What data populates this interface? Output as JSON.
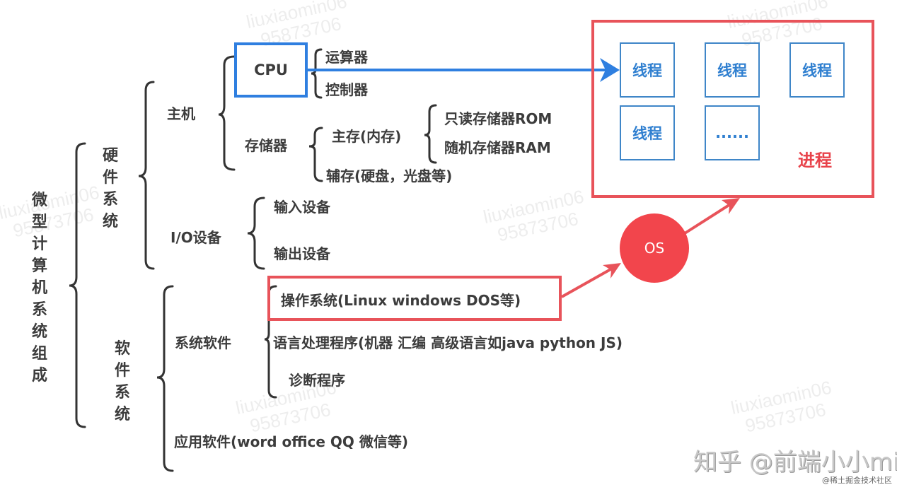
{
  "diagram": {
    "root": "微型计算机系统组成",
    "hardware": {
      "label": "硬件系统",
      "host": {
        "label": "主机",
        "cpu": {
          "label": "CPU",
          "children": [
            "运算器",
            "控制器"
          ]
        },
        "storage": {
          "label": "存储器",
          "main_memory": {
            "label": "主存(内存)",
            "children": [
              "只读存储器ROM",
              "随机存储器RAM"
            ]
          },
          "aux_memory": "辅存(硬盘，光盘等)"
        }
      },
      "io": {
        "label": "I/O设备",
        "children": [
          "输入设备",
          "输出设备"
        ]
      }
    },
    "software": {
      "label": "软件系统",
      "system_software": {
        "label": "系统软件",
        "children": [
          "操作系统(Linux windows DOS等)",
          "语言处理程序(机器 汇编 高级语言如java python JS)",
          "诊断程序"
        ]
      },
      "application_software": "应用软件(word office QQ 微信等)"
    },
    "os_node": "OS",
    "process": {
      "label": "进程",
      "threads": [
        "线程",
        "线程",
        "线程",
        "线程",
        "......"
      ]
    }
  },
  "colors": {
    "cpu_blue": "#2f7fe0",
    "thread_blue": "#3f86c8",
    "process_red": "#e8535a",
    "os_red": "#f2454c",
    "text": "#3c3c3c"
  },
  "watermarks": {
    "text_line1": "liuxiaomin06",
    "text_line2": "95873706",
    "zhihu": "知乎 @前端小小mi",
    "juejin": "@稀土掘金技术社区"
  }
}
